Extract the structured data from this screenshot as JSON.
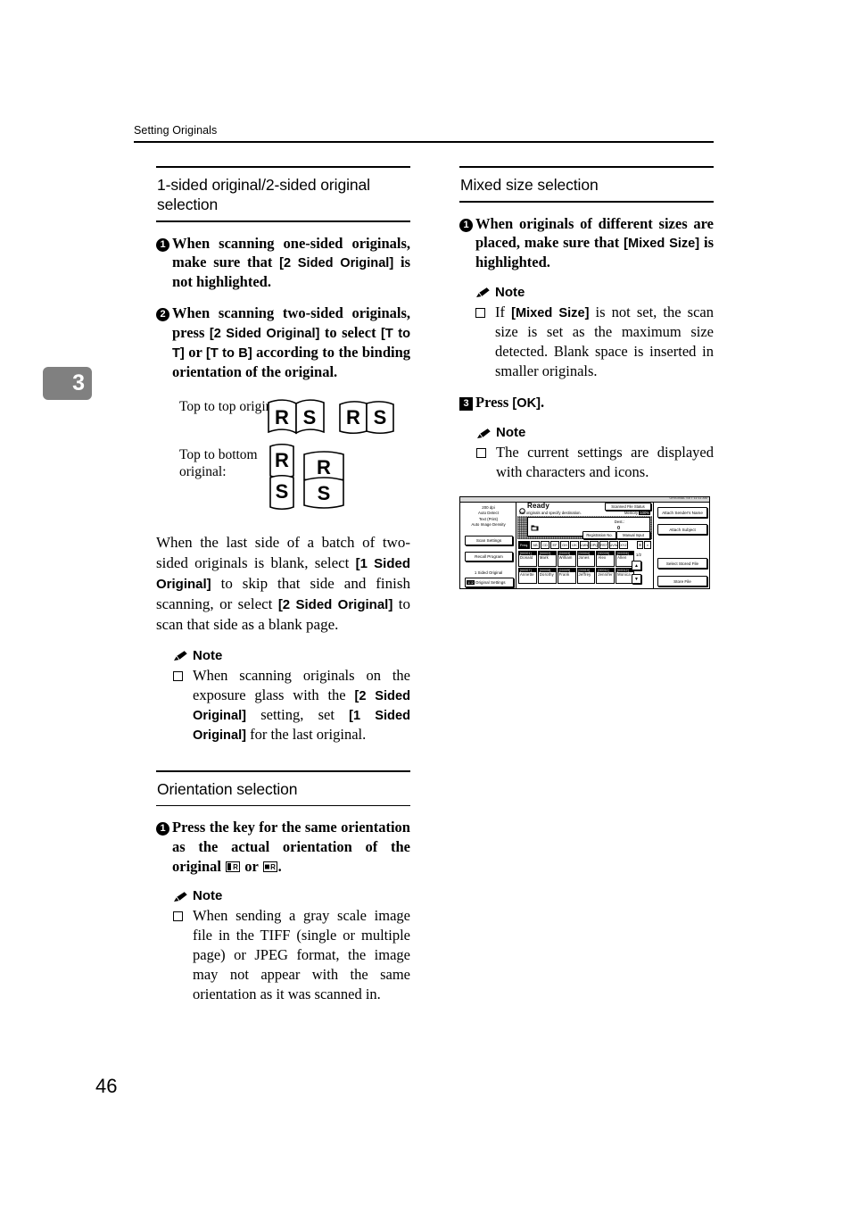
{
  "running_head": "Setting Originals",
  "chapter_tab": "3",
  "page_number": "46",
  "left_column": {
    "section1": {
      "title": "1-sided original/2-sided original selection",
      "steps": [
        {
          "marker": "1",
          "parts": [
            {
              "t": "When scanning one-sided originals, make sure that ",
              "b": false
            },
            {
              "t": "[2 Sided Original]",
              "b": true
            },
            {
              "t": " is not highlighted.",
              "b": false
            }
          ]
        },
        {
          "marker": "2",
          "parts": [
            {
              "t": "When scanning two-sided originals, press ",
              "b": false
            },
            {
              "t": "[2 Sided Original]",
              "b": true
            },
            {
              "t": " to select ",
              "b": false
            },
            {
              "t": "[T to T]",
              "b": true
            },
            {
              "t": " or ",
              "b": false
            },
            {
              "t": "[T to B]",
              "b": true
            },
            {
              "t": " according to the binding orientation of the original.",
              "b": false
            }
          ]
        }
      ],
      "diagram": {
        "label_top": "Top to top original:",
        "label_bottom": "Top to bottom original:",
        "letters": [
          "R",
          "S"
        ]
      },
      "paragraph": [
        {
          "t": "When the last side of a batch of two-sided originals is blank, select ",
          "b": false
        },
        {
          "t": "[1 Sided Original]",
          "b": true
        },
        {
          "t": " to skip that side and finish scanning, or select ",
          "b": false
        },
        {
          "t": "[2 Sided Original]",
          "b": true
        },
        {
          "t": " to scan that side as a blank page.",
          "b": false
        }
      ],
      "note": {
        "heading": "Note",
        "items": [
          [
            {
              "t": "When scanning originals on the exposure glass with the ",
              "b": false
            },
            {
              "t": "[2 Sided Original]",
              "b": true
            },
            {
              "t": " setting, set ",
              "b": false
            },
            {
              "t": "[1 Sided Original]",
              "b": true
            },
            {
              "t": " for the last original.",
              "b": false
            }
          ]
        ]
      }
    },
    "section2": {
      "title": "Orientation selection",
      "steps": [
        {
          "marker": "1",
          "parts": [
            {
              "t": "Press the key for the same orientation as the actual orientation of the original ",
              "b": false
            },
            {
              "t": "ICON:orientation-key-portrait",
              "b": false
            },
            {
              "t": " or ",
              "b": false
            },
            {
              "t": "ICON:orientation-key-landscape",
              "b": false
            },
            {
              "t": ".",
              "b": false
            }
          ]
        }
      ],
      "note": {
        "heading": "Note",
        "items": [
          [
            {
              "t": "When sending a gray scale image file in the TIFF (single or multiple page) or JPEG format, the image may not appear with the same orientation as it was scanned in.",
              "b": false
            }
          ]
        ]
      }
    }
  },
  "right_column": {
    "section1": {
      "title": "Mixed size selection",
      "steps": [
        {
          "marker": "1",
          "parts": [
            {
              "t": "When originals of different sizes are placed, make sure that ",
              "b": false
            },
            {
              "t": "[Mixed Size]",
              "b": true
            },
            {
              "t": " is highlighted.",
              "b": false
            }
          ]
        }
      ],
      "note": {
        "heading": "Note",
        "items": [
          [
            {
              "t": "If ",
              "b": false
            },
            {
              "t": "[Mixed Size]",
              "b": true
            },
            {
              "t": " is not set, the scan size is set as the maximum size detected. Blank space is inserted in smaller originals.",
              "b": false
            }
          ]
        ]
      },
      "step_ok": {
        "marker": "3",
        "parts": [
          {
            "t": "Press ",
            "b": false
          },
          {
            "t": "[OK]",
            "b": true
          },
          {
            "t": ".",
            "b": false
          }
        ]
      },
      "note2": {
        "heading": "Note",
        "items": [
          [
            {
              "t": "The current settings are displayed with characters and icons.",
              "b": false
            }
          ]
        ]
      }
    },
    "lcd_figure": {
      "top_bar_text": "ORIGINAL SET  11:11 AM",
      "status_title": "Ready",
      "status_sub": "Set originals and specify destination.",
      "scanned_file_status_button": "Scanned File Status",
      "memory_label": "Memory",
      "memory_value": "100%",
      "dest_label": "Dest.:",
      "dest_value": "0",
      "registration_no_button": "Registration No.",
      "manual_input_button": "Manual Input",
      "left_settings": [
        "200 dpi",
        "Auto Detect",
        "Text (Print)",
        "Auto Image Density"
      ],
      "left_buttons": [
        "Scan Settings",
        "Recall Program"
      ],
      "left_original_label": "1 Sided Original",
      "left_original_settings_button": "Original Settings",
      "right_buttons": [
        "Attach Sender's Name",
        "Attach Subject",
        "Select Stored File",
        "Store File"
      ],
      "tabs": [
        "Freq.",
        "AB",
        "CD",
        "EF",
        "GH",
        "IJK",
        "LMN",
        "OPQ",
        "RST",
        "UVW",
        "XYZ"
      ],
      "selected_tab": "Freq.",
      "page_indicator": "1/2",
      "addresses": [
        {
          "id": "[00001]",
          "name": "Donald"
        },
        {
          "id": "[00002]",
          "name": "Mark"
        },
        {
          "id": "[00003]",
          "name": "William"
        },
        {
          "id": "[00004]",
          "name": "Jones"
        },
        {
          "id": "[00005]",
          "name": "Alex"
        },
        {
          "id": "[00006]",
          "name": "Allen"
        },
        {
          "id": "[00007]",
          "name": "Annette"
        },
        {
          "id": "[00008]",
          "name": "Dorothy"
        },
        {
          "id": "[00009]",
          "name": "Frank"
        },
        {
          "id": "[00010]",
          "name": "Jeffrey"
        },
        {
          "id": "[00011]",
          "name": "Jennifer"
        },
        {
          "id": "[00012]",
          "name": "Monica"
        }
      ]
    }
  }
}
